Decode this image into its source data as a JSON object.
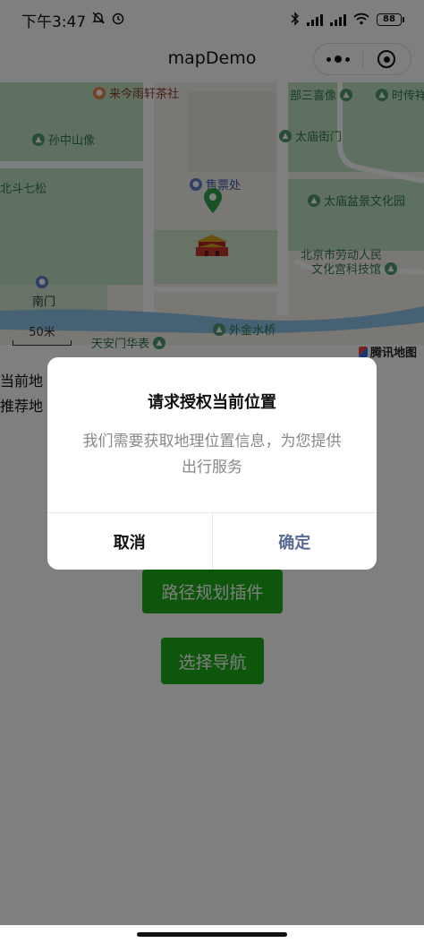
{
  "status_bar": {
    "time": "下午3:47",
    "battery": "88"
  },
  "nav": {
    "title": "mapDemo"
  },
  "map": {
    "pois": [
      {
        "label": "来今雨轩茶社",
        "kind": "food"
      },
      {
        "label": "孙中山像",
        "kind": "scenic"
      },
      {
        "label": "部三喜像",
        "kind": "scenic"
      },
      {
        "label": "时传祥",
        "kind": "scenic"
      },
      {
        "label": "太庙街门",
        "kind": "scenic"
      },
      {
        "label": "北斗七松",
        "kind": "scenic"
      },
      {
        "label": "售票处",
        "kind": "ticket"
      },
      {
        "label": "太庙盆景文化园",
        "kind": "scenic"
      },
      {
        "label": "北京市劳动人民",
        "kind": "place"
      },
      {
        "label": "文化宫科技馆",
        "kind": "place"
      },
      {
        "label": "南门",
        "kind": "gate"
      },
      {
        "label": "外金水桥",
        "kind": "scenic"
      },
      {
        "label": "天安门华表",
        "kind": "scenic"
      }
    ],
    "scale_label": "50米",
    "brand": "腾讯地图"
  },
  "page": {
    "line1": "当前地",
    "line2": "推荐地",
    "route_plugin_button": "路径规划插件",
    "choose_nav_button": "选择导航"
  },
  "dialog": {
    "title": "请求授权当前位置",
    "content": "我们需要获取地理位置信息，为您提供出行服务",
    "cancel": "取消",
    "confirm": "确定"
  },
  "colors": {
    "primary_green": "#1aad19",
    "confirm_text": "#576b95",
    "mask": "rgba(0,0,0,0.5)"
  }
}
